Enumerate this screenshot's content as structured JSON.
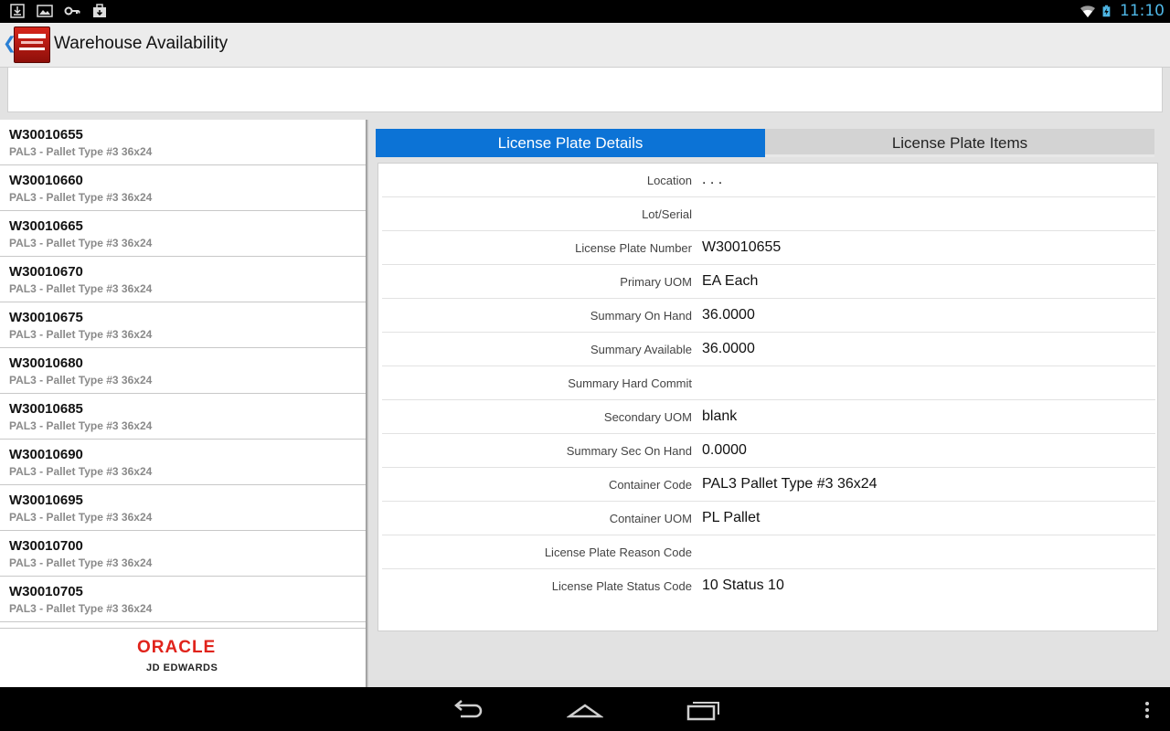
{
  "status_bar": {
    "time": "11:10",
    "icons": [
      "download-icon",
      "image-icon",
      "key-icon",
      "briefcase-icon",
      "wifi-icon",
      "battery-charging-icon"
    ]
  },
  "app": {
    "title": "Warehouse Availability",
    "logo": "oracle-jd-edwards-logo",
    "accent_color": "#0c73d6"
  },
  "search": {
    "value": ""
  },
  "list": {
    "items": [
      {
        "id": "W30010655",
        "desc": "PAL3 - Pallet Type #3 36x24"
      },
      {
        "id": "W30010660",
        "desc": "PAL3 - Pallet Type #3 36x24"
      },
      {
        "id": "W30010665",
        "desc": "PAL3 - Pallet Type #3 36x24"
      },
      {
        "id": "W30010670",
        "desc": "PAL3 - Pallet Type #3 36x24"
      },
      {
        "id": "W30010675",
        "desc": "PAL3 - Pallet Type #3 36x24"
      },
      {
        "id": "W30010680",
        "desc": "PAL3 - Pallet Type #3 36x24"
      },
      {
        "id": "W30010685",
        "desc": "PAL3 - Pallet Type #3 36x24"
      },
      {
        "id": "W30010690",
        "desc": "PAL3 - Pallet Type #3 36x24"
      },
      {
        "id": "W30010695",
        "desc": "PAL3 - Pallet Type #3 36x24"
      },
      {
        "id": "W30010700",
        "desc": "PAL3 - Pallet Type #3 36x24"
      },
      {
        "id": "W30010705",
        "desc": "PAL3 - Pallet Type #3 36x24"
      }
    ],
    "footer": {
      "brand": "ORACLE",
      "product": "JD EDWARDS"
    }
  },
  "tabs": {
    "details": "License Plate Details",
    "items": "License Plate Items"
  },
  "details": [
    {
      "label": "Location",
      "value": ". . ."
    },
    {
      "label": "Lot/Serial",
      "value": ""
    },
    {
      "label": "License Plate Number",
      "value": "W30010655"
    },
    {
      "label": "Primary UOM",
      "value": "EA Each"
    },
    {
      "label": "Summary On Hand",
      "value": "36.0000"
    },
    {
      "label": "Summary Available",
      "value": "36.0000"
    },
    {
      "label": "Summary Hard Commit",
      "value": ""
    },
    {
      "label": "Secondary UOM",
      "value": "blank"
    },
    {
      "label": "Summary Sec On Hand",
      "value": "0.0000"
    },
    {
      "label": "Container Code",
      "value": "PAL3 Pallet Type #3 36x24"
    },
    {
      "label": "Container UOM",
      "value": "PL Pallet"
    },
    {
      "label": "License Plate Reason Code",
      "value": ""
    },
    {
      "label": "License Plate Status Code",
      "value": "10 Status 10"
    }
  ],
  "nav_bar": {
    "buttons": [
      "back-icon",
      "home-icon",
      "recent-apps-icon",
      "overflow-menu-icon"
    ]
  }
}
